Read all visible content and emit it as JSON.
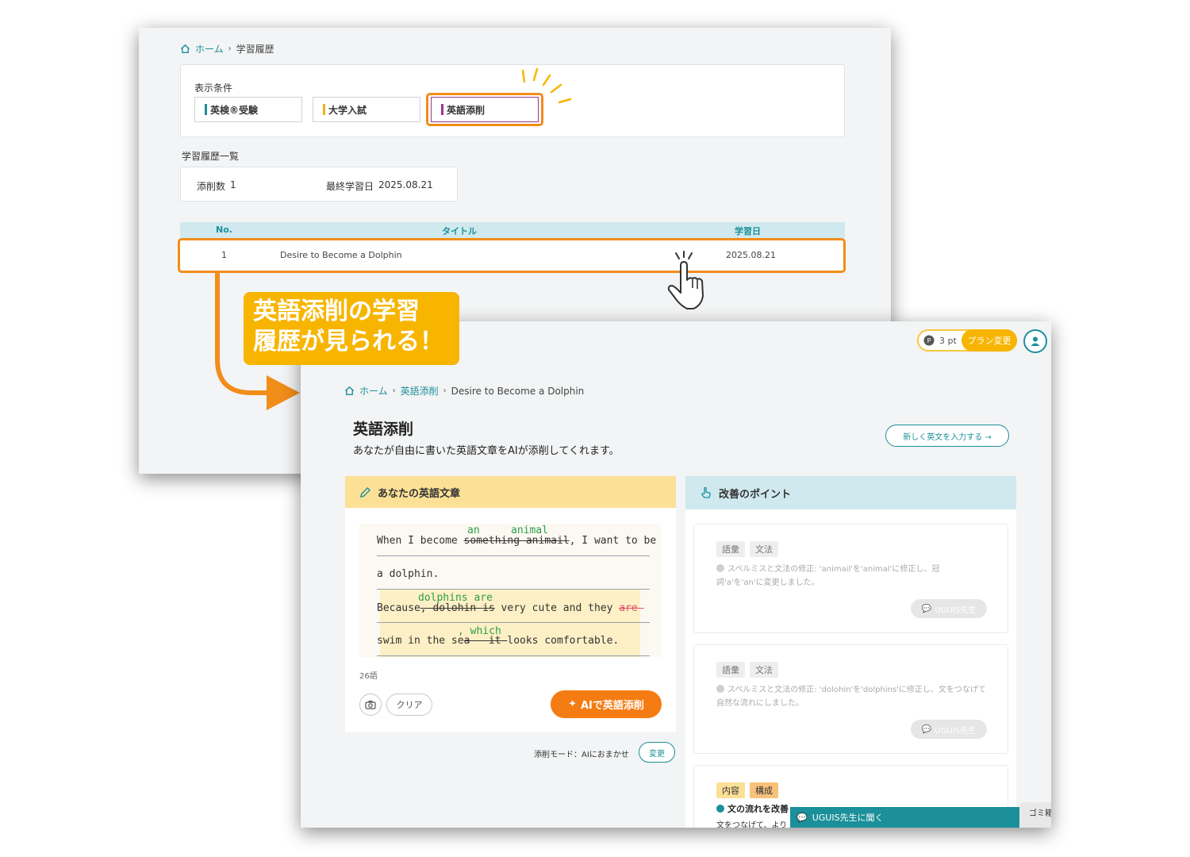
{
  "back": {
    "breadcrumb": {
      "home": "ホーム",
      "current": "学習履歴"
    },
    "filter": {
      "label": "表示条件",
      "tabs": [
        {
          "label": "英検®受験",
          "bar_color": "#1b8f9a"
        },
        {
          "label": "大学入試",
          "bar_color": "#f2b21b"
        },
        {
          "label": "英語添削",
          "bar_color": "#a0348e"
        }
      ]
    },
    "list_title": "学習履歴一覧",
    "summary": {
      "count_label": "添削数",
      "count": "1",
      "last_label": "最終学習日",
      "last_date": "2025.08.21"
    },
    "table": {
      "headers": {
        "no": "No.",
        "title": "タイトル",
        "date": "学習日"
      },
      "rows": [
        {
          "no": "1",
          "title": "Desire to Become a Dolphin",
          "date": "2025.08.21"
        }
      ]
    }
  },
  "callout": {
    "line1": "英語添削の学習",
    "line2": "履歴が見られる！"
  },
  "front": {
    "points": {
      "value": "3 pt",
      "plan_button": "プラン変更"
    },
    "breadcrumb": {
      "home": "ホーム",
      "section": "英語添削",
      "current": "Desire to Become a Dolphin"
    },
    "title": "英語添削",
    "subtitle": "あなたが自由に書いた英語文章をAIが添削してくれます。",
    "new_button": "新しく英文を入力する →",
    "essay_card": {
      "heading": "あなたの英語文章",
      "lines": {
        "l1_pre": "When I become ",
        "l1_del": "something animail",
        "l1_post": ", I want to be",
        "l1_ins_a": "an",
        "l1_ins_b": "animal",
        "l2": "a dolphin.",
        "l3_pre": "Because",
        "l3_del": ", dolohin is",
        "l3_mid": " very cute and they ",
        "l3_del2": "are ",
        "l3_ins": "dolphins are",
        "l4_pre": "swim in the se",
        "l4_del": "a   it ",
        "l4_post": "looks comfortable.",
        "l4_ins": ", which"
      },
      "word_count": "26語",
      "clear_button": "クリア",
      "ai_button": "AIで英語添削"
    },
    "mode": {
      "label": "添削モード：AIにおまかせ",
      "change_button": "変更"
    },
    "points_card": {
      "heading": "改善のポイント",
      "items": [
        {
          "tags": [
            "語彙",
            "文法"
          ],
          "text": "スペルミスと文法の修正: 'animail'を'animal'に修正し、冠詞'a'を'an'に変更しました。",
          "ask": "UGUIS先生"
        },
        {
          "tags": [
            "語彙",
            "文法"
          ],
          "text": "スペルミスと文法の修正: 'dolohin'を'dolphins'に修正し、文をつなげて自然な流れにしました。",
          "ask": "UGUIS先生"
        }
      ],
      "third": {
        "tags": [
          "内容",
          "構成"
        ],
        "title": "文の流れを改善",
        "text": "文をつなげて、より"
      }
    },
    "chat_bar": "UGUIS先生に聞く",
    "trash": "ゴミ箱"
  },
  "colors": {
    "teal": "#1b8f9a",
    "orange": "#f18d19",
    "yellow": "#f7b500",
    "ai_orange": "#f57c12"
  }
}
